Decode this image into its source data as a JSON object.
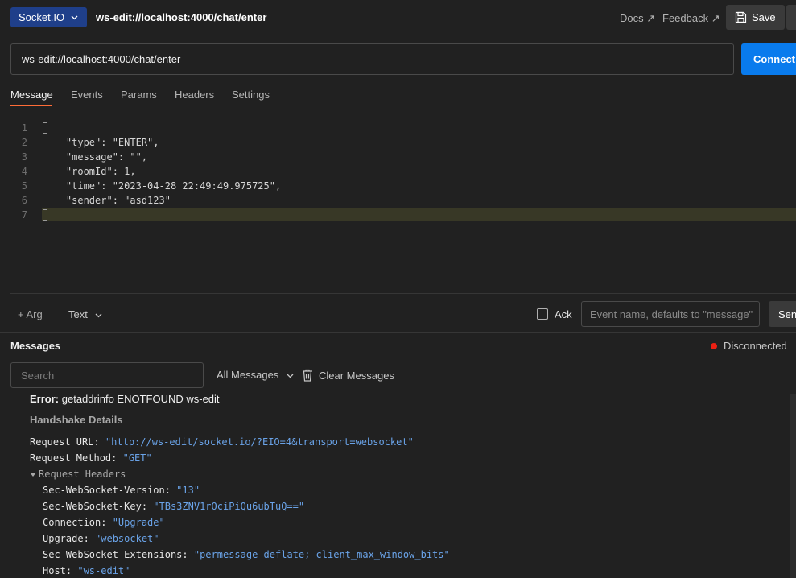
{
  "topbar": {
    "protocol": "Socket.IO",
    "request_title": "ws-edit://localhost:4000/chat/enter",
    "docs_label": "Docs ↗",
    "feedback_label": "Feedback ↗",
    "save_label": "Save"
  },
  "url": {
    "value": "ws-edit://localhost:4000/chat/enter",
    "connect_label": "Connect"
  },
  "tabs": [
    {
      "label": "Message",
      "active": true
    },
    {
      "label": "Events"
    },
    {
      "label": "Params"
    },
    {
      "label": "Headers"
    },
    {
      "label": "Settings"
    }
  ],
  "editor": {
    "line_numbers": [
      "1",
      "2",
      "3",
      "4",
      "5",
      "6",
      "7"
    ],
    "lines": [
      "",
      "    \"type\": \"ENTER\",",
      "    \"message\": \"\",",
      "    \"roomId\": 1,",
      "    \"time\": \"2023-04-28 22:49:49.975725\",",
      "    \"sender\": \"asd123\"",
      ""
    ]
  },
  "argbar": {
    "arg_label": "+ Arg",
    "format_label": "Text",
    "ack_label": "Ack",
    "event_placeholder": "Event name, defaults to \"message\"",
    "send_label": "Send"
  },
  "messages": {
    "title": "Messages",
    "status": "Disconnected",
    "status_color": "#eb2013",
    "search_placeholder": "Search",
    "filter_label": "All Messages",
    "clear_label": "Clear Messages",
    "error_prefix": "Error:",
    "error_text": "getaddrinfo ENOTFOUND ws-edit",
    "handshake_title": "Handshake Details",
    "request_url_key": "Request URL: ",
    "request_url_val": "\"http://ws-edit/socket.io/?EIO=4&transport=websocket\"",
    "request_method_key": "Request Method: ",
    "request_method_val": "\"GET\"",
    "request_headers_label": "Request Headers",
    "headers": [
      {
        "key": "Sec-WebSocket-Version: ",
        "value": "\"13\""
      },
      {
        "key": "Sec-WebSocket-Key: ",
        "value": "\"TBs3ZNV1rOciPiQu6ubTuQ==\""
      },
      {
        "key": "Connection: ",
        "value": "\"Upgrade\""
      },
      {
        "key": "Upgrade: ",
        "value": "\"websocket\""
      },
      {
        "key": "Sec-WebSocket-Extensions: ",
        "value": "\"permessage-deflate; client_max_window_bits\""
      },
      {
        "key": "Host: ",
        "value": "\"ws-edit\""
      }
    ]
  },
  "colors": {
    "accent_tab": "#ff6c37",
    "connect_bg": "#097bed",
    "protocol_bg": "#1f3f8a",
    "string_value": "#6aa3e8"
  }
}
